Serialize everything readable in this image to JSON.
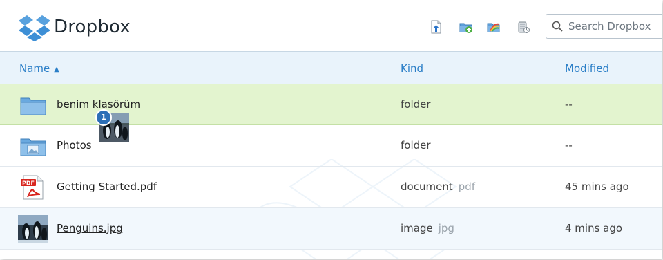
{
  "app": {
    "title": "Dropbox"
  },
  "toolbar": {
    "upload_icon": "upload-file-icon",
    "new_folder_icon": "new-folder-icon",
    "share_folder_icon": "share-folder-icon",
    "deleted_files_icon": "show-deleted-files-icon"
  },
  "search": {
    "placeholder": "Search Dropbox"
  },
  "columns": {
    "name": "Name",
    "sort_indicator": "▲",
    "kind": "Kind",
    "modified": "Modified"
  },
  "rows": [
    {
      "name": "benim klasörüm",
      "kind": "folder",
      "ext": "",
      "modified": "--",
      "icon": "folder-icon",
      "state": "drop-target"
    },
    {
      "name": "Photos",
      "kind": "folder",
      "ext": "",
      "modified": "--",
      "icon": "photos-folder-icon",
      "state": "normal"
    },
    {
      "name": "Getting Started.pdf",
      "kind": "document",
      "ext": "pdf",
      "modified": "45 mins ago",
      "icon": "pdf-icon",
      "state": "normal"
    },
    {
      "name": "Penguins.jpg",
      "kind": "image",
      "ext": "jpg",
      "modified": "4 mins ago",
      "icon": "penguins-thumbnail",
      "state": "hover"
    }
  ],
  "drag": {
    "count": "1"
  },
  "colors": {
    "accent": "#2a7ec7",
    "drop_target_bg": "#e3f4cf",
    "header_bg": "#e9f3fb"
  }
}
